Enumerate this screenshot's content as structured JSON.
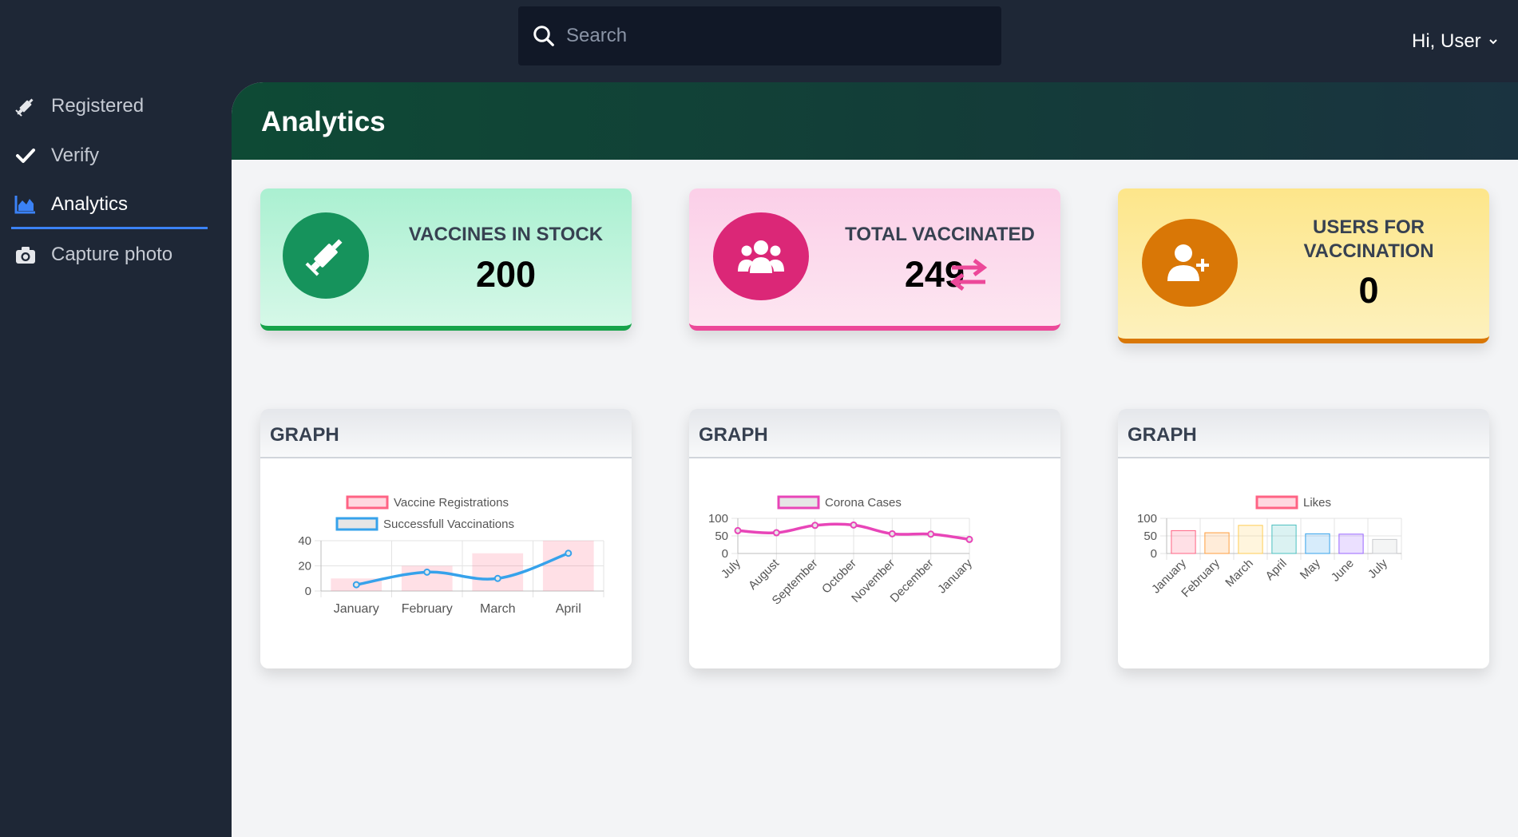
{
  "search": {
    "placeholder": "Search"
  },
  "user": {
    "greeting": "Hi, User"
  },
  "sidebar": {
    "items": [
      {
        "label": "Registered",
        "icon": "syringe-icon"
      },
      {
        "label": "Verify",
        "icon": "check-icon"
      },
      {
        "label": "Analytics",
        "icon": "area-chart-icon",
        "active": true
      },
      {
        "label": "Capture photo",
        "icon": "camera-icon"
      }
    ]
  },
  "page": {
    "title": "Analytics"
  },
  "stats": {
    "vaccines": {
      "label": "VACCINES IN STOCK",
      "value": "200",
      "color": "#16a34a"
    },
    "vaccinated": {
      "label": "TOTAL VACCINATED",
      "value": "249",
      "color": "#db2777"
    },
    "users": {
      "label_line1": "USERS FOR",
      "label_line2": "VACCINATION",
      "value": "0",
      "color": "#d97706"
    }
  },
  "graphs": {
    "title": "GRAPH"
  },
  "chart_data": [
    {
      "type": "bar",
      "categories": [
        "January",
        "February",
        "March",
        "April"
      ],
      "series": [
        {
          "name": "Vaccine Registrations",
          "type": "bar",
          "values": [
            10,
            20,
            30,
            40
          ],
          "color": "#ff6384"
        },
        {
          "name": "Successfull Vaccinations",
          "type": "line",
          "values": [
            5,
            15,
            10,
            30
          ],
          "color": "#36a2eb"
        }
      ],
      "ylim": [
        0,
        40
      ],
      "yticks": [
        0,
        20,
        40
      ],
      "grid": true,
      "legend": "top"
    },
    {
      "type": "line",
      "categories": [
        "July",
        "August",
        "September",
        "October",
        "November",
        "December",
        "January"
      ],
      "series": [
        {
          "name": "Corona Cases",
          "values": [
            65,
            59,
            80,
            81,
            56,
            55,
            40
          ],
          "color": "#e845b8"
        }
      ],
      "ylim": [
        0,
        100
      ],
      "yticks": [
        0,
        50,
        100
      ],
      "grid": true,
      "legend": "top"
    },
    {
      "type": "bar",
      "categories": [
        "January",
        "February",
        "March",
        "April",
        "May",
        "June",
        "July"
      ],
      "series": [
        {
          "name": "Likes",
          "values": [
            65,
            59,
            80,
            81,
            56,
            55,
            40
          ],
          "colors": [
            "#ff6384",
            "#ff9f40",
            "#ffcd56",
            "#4bc0c0",
            "#36a2eb",
            "#9966ff",
            "#c9cbcf"
          ]
        }
      ],
      "ylim": [
        0,
        100
      ],
      "yticks": [
        0,
        50,
        100
      ],
      "grid": true,
      "legend": "top"
    }
  ]
}
